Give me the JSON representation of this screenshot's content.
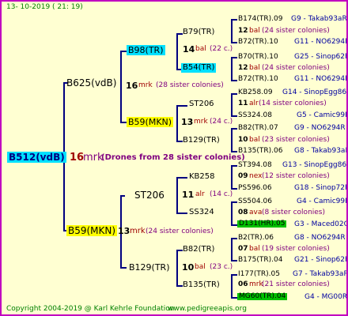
{
  "header": {
    "date": "13- 10-2019 ( 21: 19)"
  },
  "root": {
    "name": "B512(vdB)"
  },
  "drones": {
    "count": "16",
    "abbr": "mrk",
    "note": "(Drones from 28 sister colonies)"
  },
  "g1": {
    "upper": {
      "name": "B625(vdB)"
    },
    "lower": {
      "name": "B59(MKN)",
      "count": "13",
      "abbr": "mrk",
      "note": "(24 sister colonies)"
    }
  },
  "g2": {
    "a": {
      "name": "B98(TR)",
      "count": "16",
      "abbr": "mrk",
      "note": "(28 sister colonies)"
    },
    "b": {
      "name": "B59(MKN)",
      "count": "13",
      "abbr": "mrk",
      "note": "(24 c.)"
    },
    "c": {
      "name": "ST206",
      "count": "11",
      "abbr": "alr",
      "note": "(14 c.)"
    },
    "d": {
      "name": "B129(TR)",
      "count": "10",
      "abbr": "bal",
      "note": "(23 c.)"
    }
  },
  "g3": {
    "a1": {
      "name": "B79(TR)",
      "count": "14",
      "abbr": "bal",
      "note": "(22 c.)"
    },
    "a2": {
      "name": "B54(TR)",
      "count": "12",
      "abbr": "bal",
      "note": "(24 sister colonies)"
    },
    "b1": {
      "name": "ST206",
      "count": "11",
      "abbr": "alr",
      "note": "(14 sister colonies)"
    },
    "b2": {
      "name": "B129(TR)",
      "count": "10",
      "abbr": "bal",
      "note": "(23 sister colonies)"
    },
    "c1": {
      "name": "KB258",
      "count": "09",
      "abbr": "nex",
      "note": "(12 sister colonies)"
    },
    "c2": {
      "name": "SS324",
      "count": "08",
      "abbr": "ava",
      "note": "(8 sister colonies)"
    },
    "d1": {
      "name": "B82(TR)",
      "count": "07",
      "abbr": "bal",
      "note": "(19 sister colonies)"
    },
    "d2": {
      "name": "B135(TR)",
      "count": "06",
      "abbr": "mrk",
      "note": "(21 sister colonies)"
    }
  },
  "g4": [
    {
      "name": "B174(TR).09",
      "code": "G9 - Takab93aR"
    },
    {
      "count": "12",
      "abbr": "bal",
      "note": "(24 sister colonies)"
    },
    {
      "name": "B72(TR).10",
      "code": "G11 - NO6294R"
    },
    {
      "name": "B70(TR).10",
      "code": "G25 - Sinop62R"
    },
    {
      "name": "B72(TR).10",
      "code": "G11 - NO6294R"
    },
    {
      "name": "KB258.09",
      "code": "G14 - SinopEgg86R"
    },
    {
      "name": "SS324.08",
      "code": "G5 - Camic99R"
    },
    {
      "name": "B82(TR).07",
      "code": "G9 - NO6294R"
    },
    {
      "name": "B135(TR).06",
      "code": "G8 - Takab93aR"
    },
    {
      "name": "ST394.08",
      "code": "G13 - SinopEgg86R"
    },
    {
      "name": "PS596.06",
      "code": "G18 - Sinop72R"
    },
    {
      "name": "SS504.06",
      "code": "G4 - Camic99R"
    },
    {
      "name": "D131(HR).05",
      "code": "G3 - Maced02Q"
    },
    {
      "name": "B2(TR).06",
      "code": "G8 - NO6294R"
    },
    {
      "name": "B175(TR).04",
      "code": "G21 - Sinop62R"
    },
    {
      "name": "I177(TR).05",
      "code": "G7 - Takab93aR"
    },
    {
      "name": "MG60(TR).04",
      "code": "G4 - MG00R"
    }
  ],
  "footer": {
    "copyright": "Copyright 2004-2019 @ Karl Kehrle Foundation",
    "site": "www.pedigreeapis.org"
  }
}
